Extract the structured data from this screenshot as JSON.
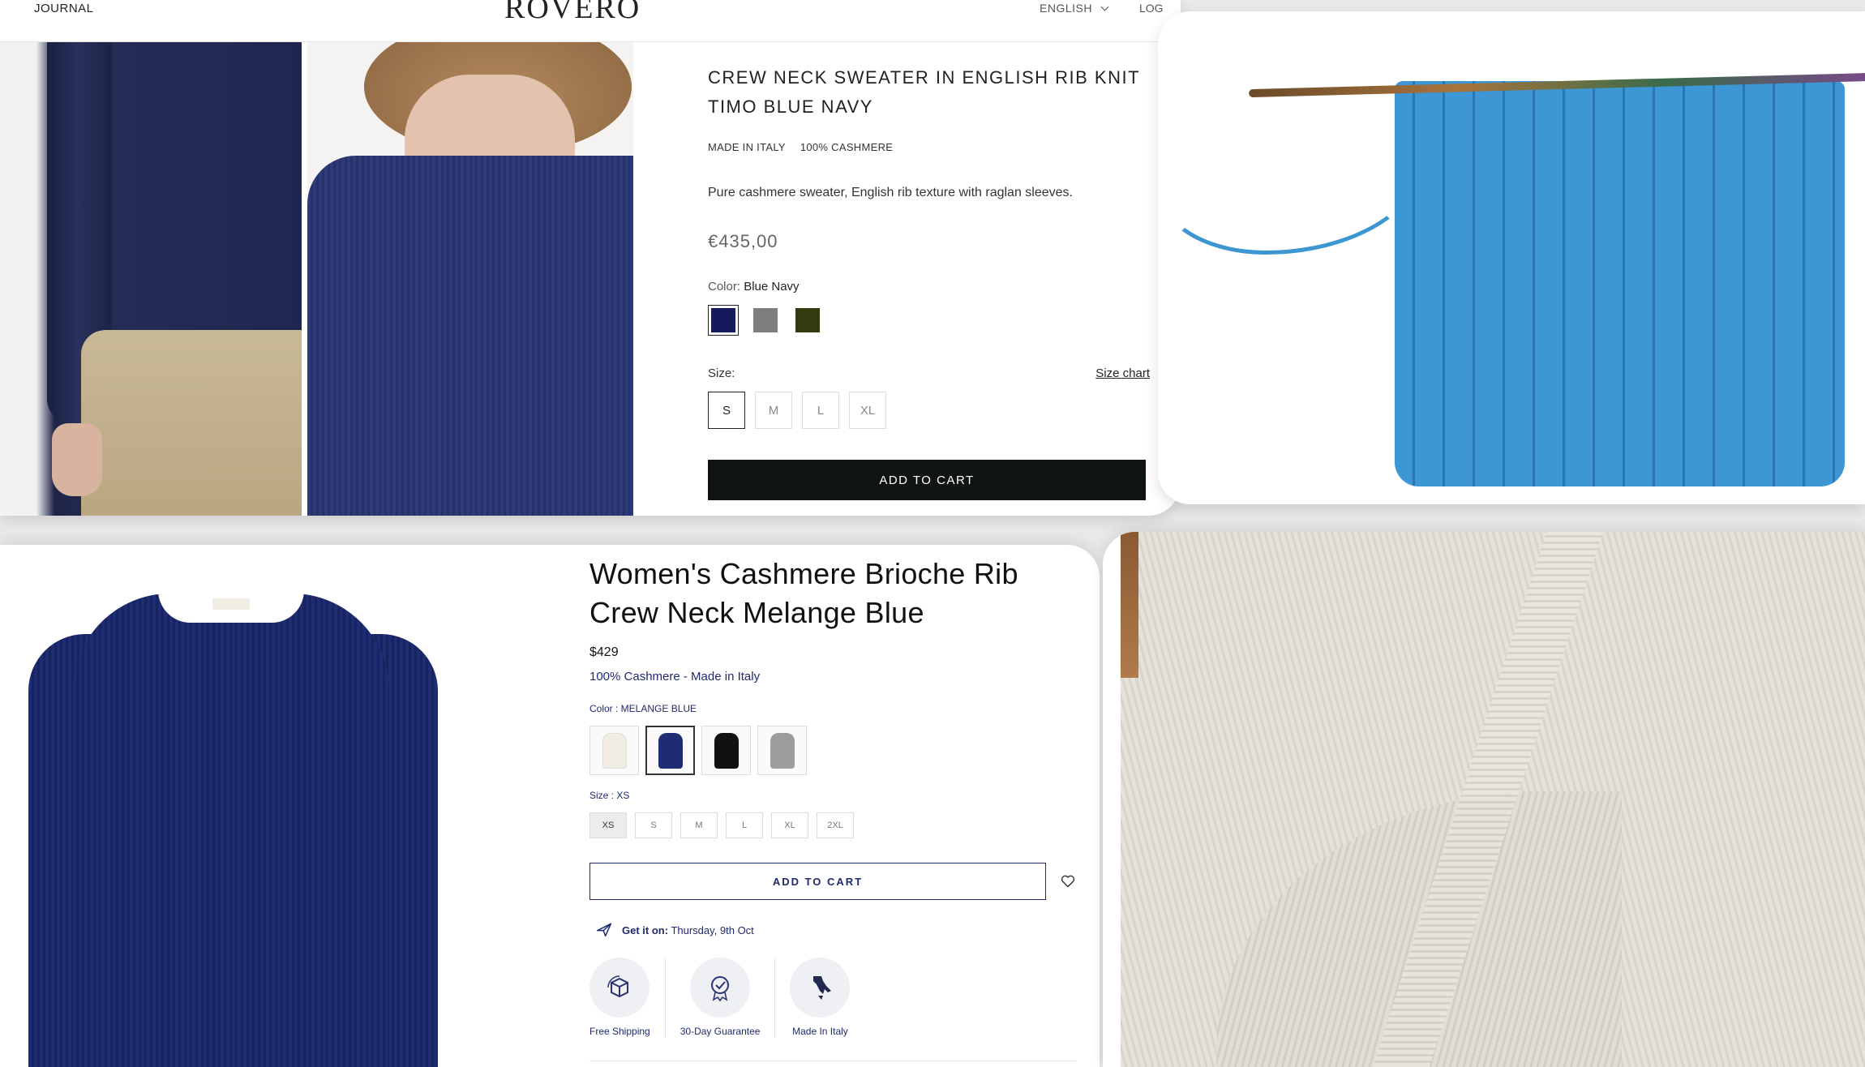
{
  "rovero": {
    "nav": {
      "journal": "JOURNAL",
      "logo": "ROVERO",
      "language": "ENGLISH",
      "login": "LOG"
    },
    "product": {
      "title_line1": "CREW NECK SWEATER IN ENGLISH RIB KNIT",
      "title_line2": "TIMO BLUE NAVY",
      "tag1": "MADE IN ITALY",
      "tag2": "100% CASHMERE",
      "description": "Pure cashmere sweater, English rib texture with raglan sleeves.",
      "price": "€435,00",
      "color_label": "Color:",
      "color_value": "Blue Navy",
      "swatches": [
        "#141a5c",
        "#7d7d7d",
        "#343a0d"
      ],
      "size_label": "Size:",
      "size_chart": "Size chart",
      "sizes": [
        "S",
        "M",
        "L",
        "XL"
      ],
      "add_to_cart": "ADD TO CART"
    }
  },
  "brioche": {
    "title": "Women's Cashmere Brioche Rib Crew Neck Melange Blue",
    "price": "$429",
    "subtitle": "100% Cashmere - Made in Italy",
    "color_label": "Color : MELANGE BLUE",
    "thumb_colors": [
      "#f1ece3",
      "#1d2c73",
      "#111111",
      "#9c9c9c"
    ],
    "size_label": "Size : XS",
    "sizes": [
      "XS",
      "S",
      "M",
      "L",
      "XL",
      "2XL"
    ],
    "add_to_cart": "ADD TO CART",
    "delivery_bold": "Get it on:",
    "delivery_date": "Thursday, 9th Oct",
    "badges": [
      "Free Shipping",
      "30-Day Guarantee",
      "Made In Italy"
    ]
  }
}
